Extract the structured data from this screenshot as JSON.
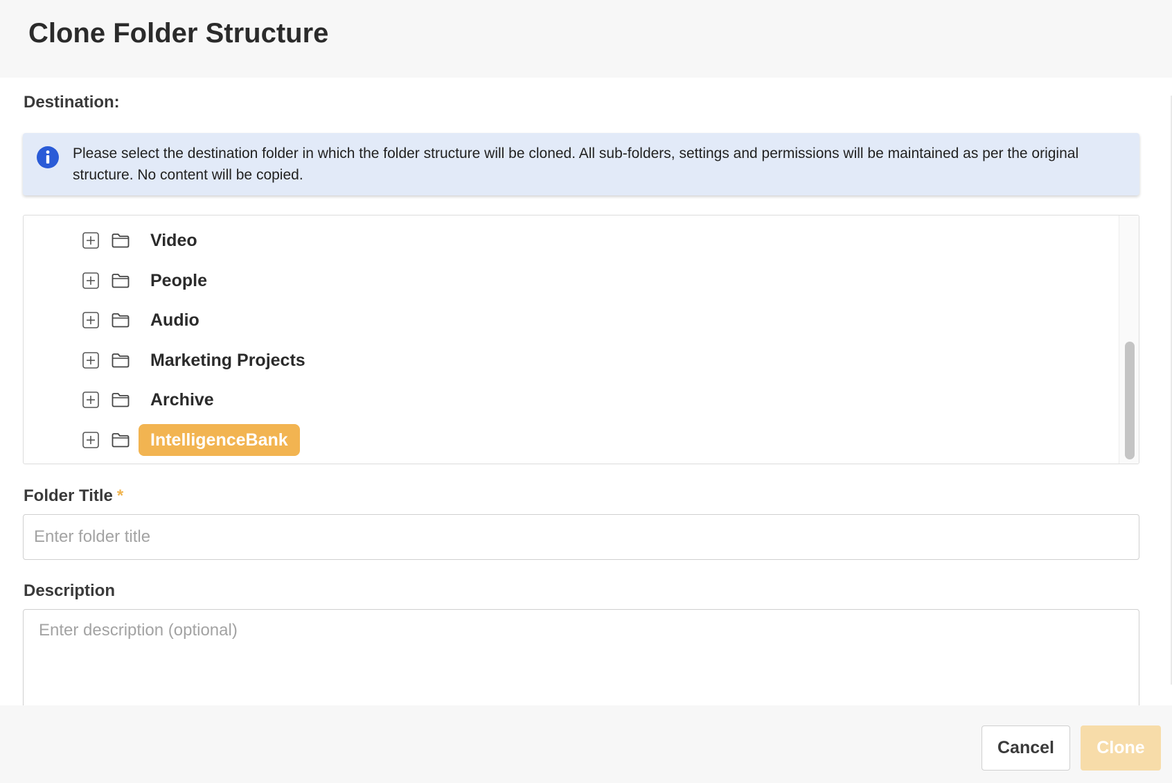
{
  "header": {
    "title": "Clone Folder Structure"
  },
  "destination": {
    "label": "Destination:",
    "info_text": "Please select the destination folder in which the folder structure will be cloned. All sub-folders, settings and permissions will be maintained as per the original structure. No content will be copied."
  },
  "tree": {
    "items": [
      {
        "label": "Video",
        "selected": false
      },
      {
        "label": "People",
        "selected": false
      },
      {
        "label": "Audio",
        "selected": false
      },
      {
        "label": "Marketing Projects",
        "selected": false
      },
      {
        "label": "Archive",
        "selected": false
      },
      {
        "label": "IntelligenceBank",
        "selected": true
      }
    ]
  },
  "folder_title": {
    "label": "Folder Title",
    "required_mark": "*",
    "placeholder": "Enter folder title",
    "value": ""
  },
  "description": {
    "label": "Description",
    "placeholder": "Enter description (optional)",
    "value": ""
  },
  "footer": {
    "cancel_label": "Cancel",
    "clone_label": "Clone"
  },
  "colors": {
    "accent": "#f2b451",
    "info_background": "#e2eaf8",
    "info_icon": "#2a5bd7",
    "disabled_button": "#f7dca9"
  }
}
